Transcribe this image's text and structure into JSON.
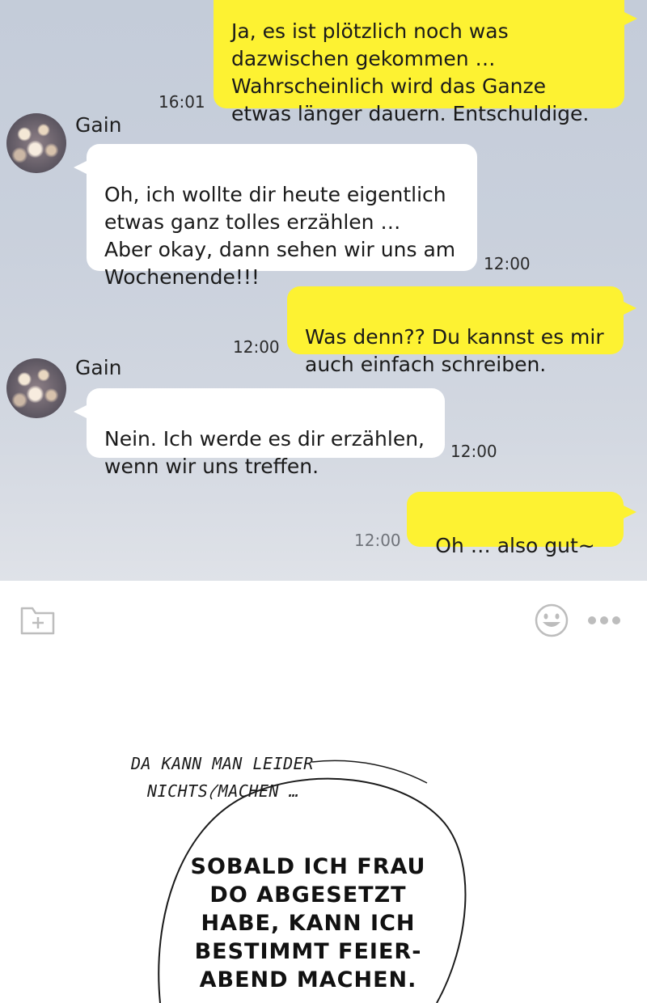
{
  "chat": {
    "messages": [
      {
        "side": "out",
        "text": "Ja, es ist plötzlich noch was\ndazwischen gekommen …\nWahrscheinlich wird das Ganze\netwas länger dauern. Entschuldige.",
        "time": "16:01"
      },
      {
        "side": "in",
        "sender": "Gain",
        "text": "Oh, ich wollte dir heute eigentlich\netwas ganz tolles erzählen …\nAber okay, dann sehen wir uns am\nWochenende!!!",
        "time": "12:00"
      },
      {
        "side": "out",
        "text": "Was denn?? Du kannst es mir\nauch einfach schreiben.",
        "time": "12:00"
      },
      {
        "side": "in",
        "sender": "Gain",
        "text": "Nein. Ich werde es dir erzählen,\nwenn wir uns treffen.",
        "time": "12:00"
      },
      {
        "side": "out",
        "text": "Oh … also gut~",
        "time": "12:00"
      }
    ]
  },
  "toolbar": {
    "icons": [
      "add-file-icon",
      "emoji-icon",
      "more-icon"
    ]
  },
  "comic": {
    "narration_line1": "DA KANN MAN LEIDER",
    "narration_line2": "NICHTS MACHEN …",
    "speech": "SOBALD ICH FRAU\nDO ABGESETZT\nHABE, KANN ICH\nBESTIMMT FEIER-\nABEND MACHEN."
  }
}
